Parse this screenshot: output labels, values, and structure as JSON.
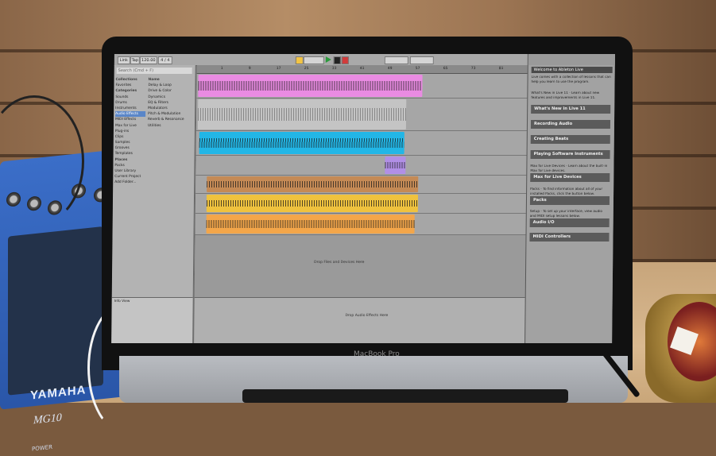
{
  "scene": {
    "laptop_brand": "MacBook Pro",
    "mixer_brand": "YAMAHA",
    "mixer_model": "MG10",
    "mixer_power_label": "POWER"
  },
  "ableton": {
    "search_placeholder": "Search (Cmd + F)",
    "collections_header": "Collections",
    "favorites": "Favorites",
    "categories_header": "Categories",
    "categories": [
      "Sounds",
      "Drums",
      "Instruments",
      "Audio Effects",
      "MIDI Effects",
      "Max for Live",
      "Plug-ins",
      "Clips",
      "Samples",
      "Grooves",
      "Templates"
    ],
    "places_header": "Places",
    "places": [
      "Packs",
      "User Library",
      "Current Project",
      "Add Folder..."
    ],
    "name_header": "Name",
    "files": [
      "Delay & Loop",
      "Drive & Color",
      "Dynamics",
      "EQ & Filters",
      "Modulators",
      "Pitch & Modulation",
      "Reverb & Resonance",
      "Utilities"
    ],
    "info_text": "Info View",
    "detail_message": "Drop Audio Effects Here",
    "empty_track_message": "Drop Files and Devices Here",
    "help_title": "Welcome to Ableton Live",
    "help_intro": "Live comes with a collection of lessons that can help you learn to use the program.",
    "help_whatsnew_text": "What's New in Live 11 - Learn about new features and improvements in Live 11.",
    "help_buttons": [
      "What's New in Live 11",
      "Recording Audio",
      "Creating Beats",
      "Playing Software Instruments",
      "Max for Live Devices",
      "Packs",
      "Audio I/O",
      "MIDI Controllers"
    ],
    "help_m4l_text": "Max for Live Devices - Learn about the built-in Max for Live devices.",
    "help_packs_text": "Packs - To find information about all of your installed Packs, click the button below.",
    "help_audio_text": "Setup - To set up your interface, view audio and MIDI setup lessons below.",
    "bar_numbers": [
      "1",
      "9",
      "17",
      "25",
      "33",
      "41",
      "49",
      "57",
      "65",
      "73",
      "81"
    ],
    "tempo": "120.00",
    "signature": "4 / 4"
  },
  "colors": {
    "pink": "#e98be2",
    "cyan": "#22b6e6",
    "purple": "#b18fe6",
    "brown": "#c58a55",
    "yellow": "#efc23e",
    "orange": "#f3a64a",
    "green": "#39d18a"
  }
}
